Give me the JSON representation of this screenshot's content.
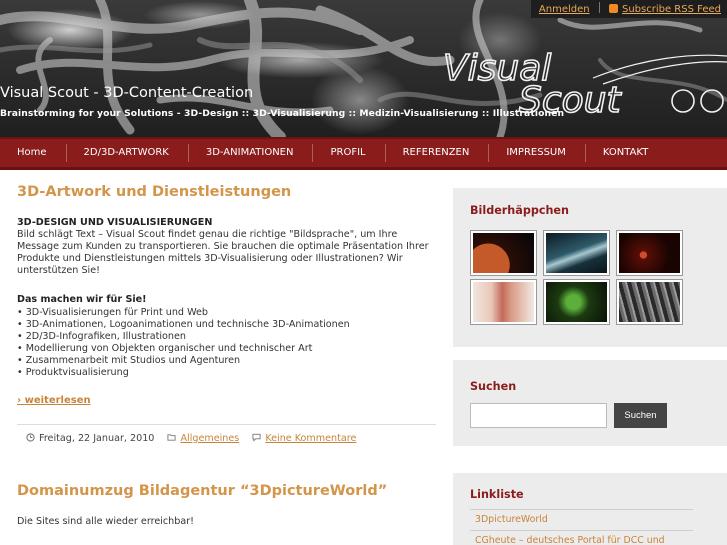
{
  "header": {
    "login_label": "Anmelden",
    "rss_label": "Subscribe RSS Feed",
    "site_title": "Visual Scout - 3D-Content-Creation",
    "site_description": "Brainstorming for your Solutions - 3D-Design :: 3D-Visualisierung :: Medizin-Visualisierung :: Illustrationen",
    "logo_line1": "Visual",
    "logo_line2": "Scout"
  },
  "nav": {
    "items": [
      {
        "label": "Home"
      },
      {
        "label": "2D/3D-ARTWORK"
      },
      {
        "label": "3D-ANIMATIONEN"
      },
      {
        "label": "PROFIL"
      },
      {
        "label": "REFERENZEN"
      },
      {
        "label": "IMPRESSUM"
      },
      {
        "label": "KONTAKT"
      }
    ]
  },
  "posts": [
    {
      "title": "3D-Artwork und Dienstleistungen",
      "heading1": "3D-DESIGN UND VISUALISIERUNGEN",
      "para1": [
        "Bild schlägt Text – Visual Scout findet genau die richtige \"Bildsprache\", um Ihre",
        "Message zum Kunden zu transportieren. Sie brauchen die optimale Präsentation Ihrer",
        "Produkte und Dienstleistungen mittels 3D-Visualisierung oder Illustrationen? Wir",
        "unterstützen Sie!"
      ],
      "heading2": "Das machen wir für Sie!",
      "list": [
        "• 3D-Visualisierungen für Print und Web",
        "• 3D-Animationen, Logoanimationen und technische 3D-Animationen",
        "• 2D/3D-Infografiken, Illustrationen",
        "• Modellierung von Objekten organischer und technischer Art",
        "• Zusammenarbeit mit Studios und Agenturen",
        "• Produktvisualisierung"
      ],
      "more_label": "› weiterlesen",
      "date": "Freitag, 22 Januar, 2010",
      "category": "Allgemeines",
      "comments": "Keine Kommentare"
    },
    {
      "title": "Domainumzug Bildagentur “3DpictureWorld”",
      "text": "Die Sites sind  alle wieder erreichbar!"
    }
  ],
  "sidebar": {
    "gallery_title": "Bilderhäppchen",
    "search_title": "Suchen",
    "search_value": "",
    "search_button": "Suchen",
    "links_title": "Linkliste",
    "links": [
      "3DpictureWorld",
      "CGheute – deutsches Portal für DCC und"
    ]
  },
  "colors": {
    "nav_bg": "#8b1c1c",
    "accent": "#d4954a",
    "link": "#c8843a",
    "widget_title": "#8b1c1c"
  }
}
